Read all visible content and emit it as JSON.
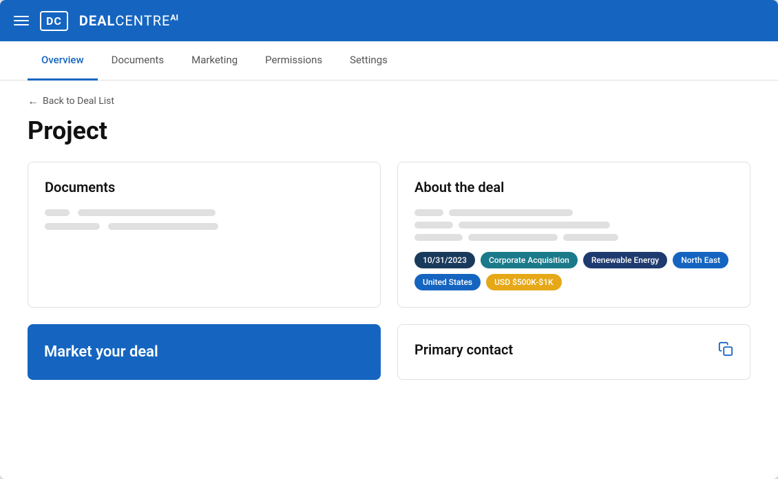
{
  "header": {
    "logo_text": "DC",
    "brand_part1": "DEAL",
    "brand_part2": "CENTRE",
    "brand_suffix": "AI",
    "hamburger_label": "menu"
  },
  "nav": {
    "tabs": [
      {
        "label": "Overview",
        "active": true
      },
      {
        "label": "Documents",
        "active": false
      },
      {
        "label": "Marketing",
        "active": false
      },
      {
        "label": "Permissions",
        "active": false
      },
      {
        "label": "Settings",
        "active": false
      }
    ]
  },
  "breadcrumb": {
    "back_label": "Back to Deal List"
  },
  "page": {
    "title": "Project"
  },
  "documents_card": {
    "title": "Documents"
  },
  "about_card": {
    "title": "About the deal",
    "badges": [
      {
        "label": "10/31/2023",
        "style": "dark-blue"
      },
      {
        "label": "Corporate Acquisition",
        "style": "teal"
      },
      {
        "label": "Renewable Energy",
        "style": "blue-dark"
      },
      {
        "label": "North East",
        "style": "blue-mid"
      },
      {
        "label": "United States",
        "style": "blue-mid"
      },
      {
        "label": "USD $500K-$1K",
        "style": "yellow"
      }
    ]
  },
  "market_card": {
    "title": "Market your deal"
  },
  "primary_contact_card": {
    "title": "Primary contact"
  }
}
